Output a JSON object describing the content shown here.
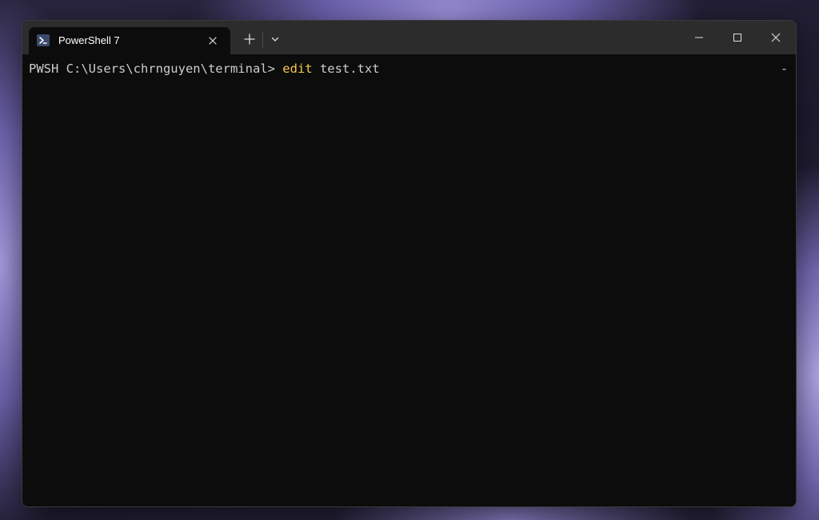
{
  "window": {
    "tab_title": "PowerShell 7"
  },
  "terminal": {
    "prompt": "PWSH C:\\Users\\chrnguyen\\terminal> ",
    "command": "edit",
    "argument": " test.txt",
    "scroll_indicator": "-"
  },
  "colors": {
    "command_highlight": "#f9c74f",
    "terminal_bg": "#0c0c0c",
    "titlebar_bg": "#2c2c2c"
  },
  "icons": {
    "tab_icon": "powershell-icon",
    "tab_close": "close-icon",
    "new_tab": "plus-icon",
    "dropdown": "chevron-down-icon",
    "minimize": "minimize-icon",
    "maximize": "maximize-icon",
    "close": "close-icon"
  }
}
